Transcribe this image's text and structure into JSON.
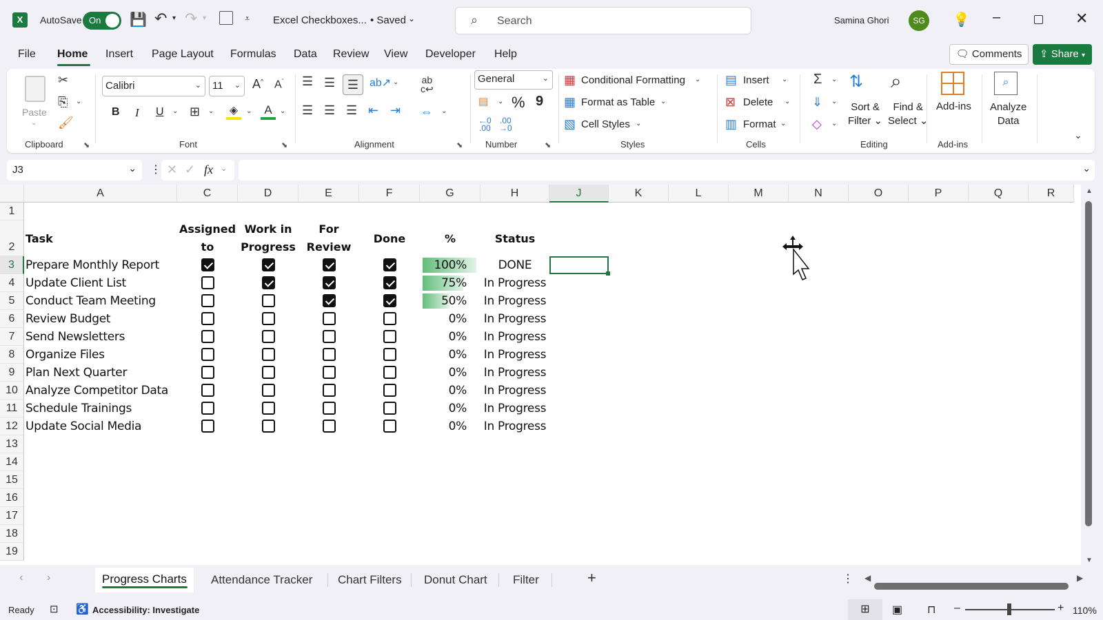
{
  "titlebar": {
    "autosave_label": "AutoSave",
    "autosave_state": "On",
    "doc_title": "Excel Checkboxes...",
    "save_state": "• Saved",
    "search_placeholder": "Search",
    "user_name": "Samina Ghori",
    "user_initials": "SG"
  },
  "menu": {
    "items": [
      "File",
      "Home",
      "Insert",
      "Page Layout",
      "Formulas",
      "Data",
      "Review",
      "View",
      "Developer",
      "Help"
    ],
    "active": "Home",
    "comments_label": "Comments",
    "share_label": "Share"
  },
  "ribbon": {
    "clipboard": {
      "paste": "Paste",
      "label": "Clipboard"
    },
    "font": {
      "family": "Calibri",
      "size": "11",
      "label": "Font",
      "bold": "B",
      "italic": "I",
      "underline": "U"
    },
    "alignment": {
      "label": "Alignment"
    },
    "number": {
      "format": "General",
      "label": "Number",
      "percent": "%",
      "comma": "9"
    },
    "styles": {
      "conditional": "Conditional Formatting",
      "format_table": "Format as Table",
      "cell_styles": "Cell Styles",
      "label": "Styles"
    },
    "cells": {
      "insert": "Insert",
      "delete": "Delete",
      "format": "Format",
      "label": "Cells"
    },
    "editing": {
      "sort1": "Sort &",
      "sort2": "Filter",
      "find1": "Find &",
      "find2": "Select",
      "label": "Editing"
    },
    "addins": {
      "btn": "Add-ins",
      "label": "Add-ins"
    },
    "analyze": {
      "line1": "Analyze",
      "line2": "Data"
    }
  },
  "formula_bar": {
    "name_box": "J3",
    "fx": "fx",
    "value": ""
  },
  "columns": [
    "A",
    "C",
    "D",
    "E",
    "F",
    "G",
    "H",
    "J",
    "K",
    "L",
    "M",
    "N",
    "O",
    "P",
    "Q",
    "R"
  ],
  "selected_column": "J",
  "rows": [
    "1",
    "2",
    "3",
    "4",
    "5",
    "6",
    "7",
    "8",
    "9",
    "10",
    "11",
    "12",
    "13",
    "14",
    "15",
    "16",
    "17",
    "18",
    "19"
  ],
  "selected_row": "3",
  "table": {
    "headers": {
      "task": "Task",
      "assigned_1": "Assigned",
      "assigned_2": "to",
      "wip_1": "Work in",
      "wip_2": "Progress",
      "review_1": "For",
      "review_2": "Review",
      "done": "Done",
      "pct": "%",
      "status": "Status"
    },
    "tasks": [
      {
        "task": "Prepare Monthly Report",
        "assigned": true,
        "wip": true,
        "review": true,
        "done": true,
        "pct": "100%",
        "pct_value": 1.0,
        "status": "DONE"
      },
      {
        "task": "Update Client List",
        "assigned": false,
        "wip": true,
        "review": true,
        "done": true,
        "pct": "75%",
        "pct_value": 0.75,
        "status": "In Progress"
      },
      {
        "task": "Conduct Team Meeting",
        "assigned": false,
        "wip": false,
        "review": true,
        "done": true,
        "pct": "50%",
        "pct_value": 0.5,
        "status": "In Progress"
      },
      {
        "task": "Review Budget",
        "assigned": false,
        "wip": false,
        "review": false,
        "done": false,
        "pct": "0%",
        "pct_value": 0,
        "status": "In Progress"
      },
      {
        "task": "Send Newsletters",
        "assigned": false,
        "wip": false,
        "review": false,
        "done": false,
        "pct": "0%",
        "pct_value": 0,
        "status": "In Progress"
      },
      {
        "task": "Organize Files",
        "assigned": false,
        "wip": false,
        "review": false,
        "done": false,
        "pct": "0%",
        "pct_value": 0,
        "status": "In Progress"
      },
      {
        "task": "Plan Next Quarter",
        "assigned": false,
        "wip": false,
        "review": false,
        "done": false,
        "pct": "0%",
        "pct_value": 0,
        "status": "In Progress"
      },
      {
        "task": "Analyze Competitor Data",
        "assigned": false,
        "wip": false,
        "review": false,
        "done": false,
        "pct": "0%",
        "pct_value": 0,
        "status": "In Progress"
      },
      {
        "task": "Schedule Trainings",
        "assigned": false,
        "wip": false,
        "review": false,
        "done": false,
        "pct": "0%",
        "pct_value": 0,
        "status": "In Progress"
      },
      {
        "task": "Update Social Media",
        "assigned": false,
        "wip": false,
        "review": false,
        "done": false,
        "pct": "0%",
        "pct_value": 0,
        "status": "In Progress"
      }
    ]
  },
  "sheet_tabs": {
    "items": [
      "Progress Charts",
      "Attendance Tracker",
      "Chart Filters",
      "Donut Chart",
      "Filter"
    ],
    "active": "Progress Charts",
    "add": "+"
  },
  "status_bar": {
    "ready": "Ready",
    "accessibility": "Accessibility: Investigate",
    "zoom": "110%",
    "zoom_value": 1.1
  },
  "colors": {
    "accent": "#1b7a3f",
    "databar": "#63be7b",
    "avatar": "#4e8a1c"
  }
}
